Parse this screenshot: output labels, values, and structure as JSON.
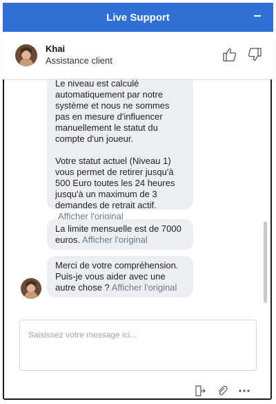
{
  "header": {
    "title": "Live Support",
    "minimize_icon": "minimize-icon"
  },
  "agent": {
    "name": "Khai",
    "role": "Assistance client"
  },
  "rating": {
    "up_icon": "thumbs-up-icon",
    "down_icon": "thumbs-down-icon"
  },
  "messages": [
    {
      "lines_1": [
        "Le niveau est calculé",
        "automatiquement par notre",
        "système et nous ne sommes",
        "pas en mesure d'influencer",
        "manuellement le statut du",
        "compte d'un joueur."
      ],
      "lines_2": [
        "Votre statut actuel (Niveau 1)",
        "vous permet de retirer jusqu'à",
        "500 Euro  toutes les 24 heures",
        "jusqu'à un maximum de 3",
        "demandes de retrait actif."
      ],
      "translate": "Afficher l'original"
    },
    {
      "text": "La limite mensuelle est de 7000 euros.",
      "translate": "Afficher l'original"
    },
    {
      "text": "Merci de votre compréhension. Puis-je vous aider avec une autre chose ?",
      "translate": "Afficher l'original"
    }
  ],
  "composer": {
    "placeholder": "Saisissez votre message ici..."
  },
  "toolbar": {
    "icons": [
      "exit-chat-icon",
      "attachment-icon",
      "more-options-icon"
    ]
  },
  "colors": {
    "header": "#2f6fd6",
    "bubble": "#eceef1",
    "link": "#6f7a88"
  }
}
